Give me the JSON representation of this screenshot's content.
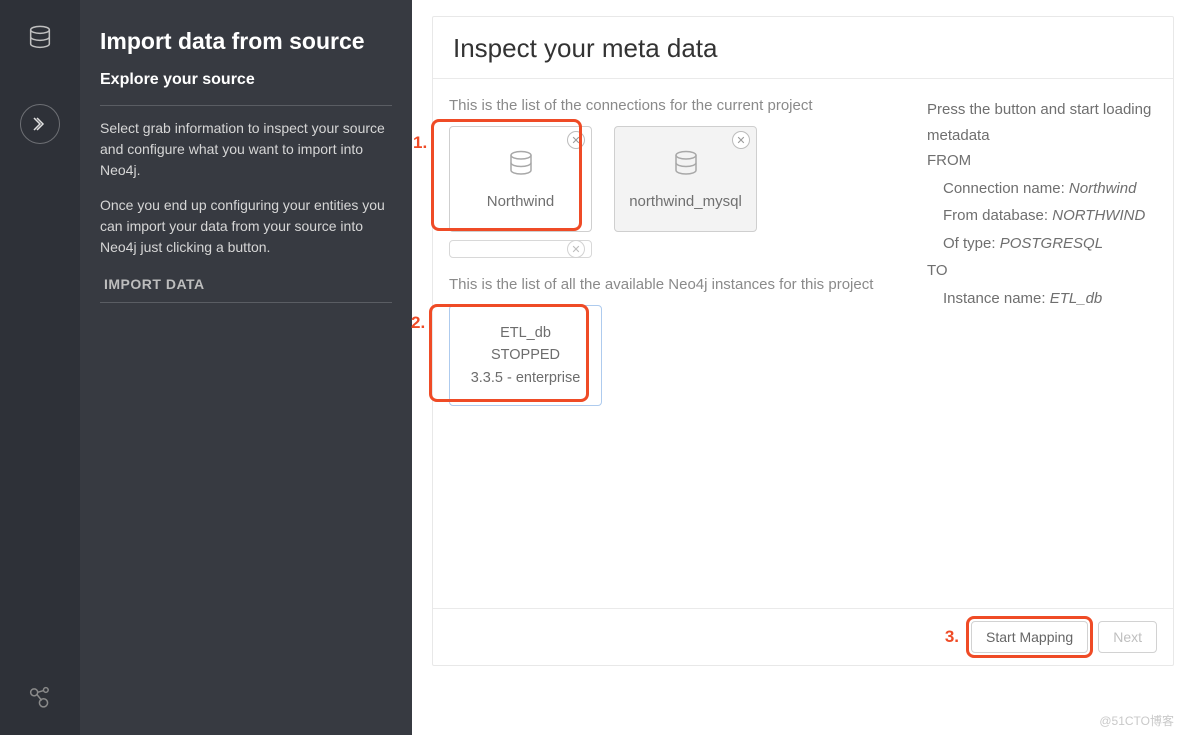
{
  "sidebar": {
    "title": "Import data from source",
    "subtitle": "Explore your source",
    "desc1": "Select grab information to inspect your source and configure what you want to import into Neo4j.",
    "desc2": "Once you end up configuring your entities you can import your data from your source into Neo4j just clicking a button.",
    "action": "IMPORT DATA"
  },
  "main": {
    "title": "Inspect your meta data",
    "connections_label": "This is the list of the connections for the current project",
    "instances_label": "This is the list of all the available Neo4j instances for this project",
    "connections": [
      {
        "name": "Northwind",
        "selected": true
      },
      {
        "name": "northwind_mysql",
        "selected": false
      }
    ],
    "instance": {
      "name": "ETL_db",
      "status": "STOPPED",
      "version": "3.3.5 - enterprise"
    }
  },
  "info": {
    "lead": "Press the button and start loading metadata",
    "from_label": "FROM",
    "conn_label": "Connection name:",
    "conn_value": "Northwind",
    "db_label": "From database:",
    "db_value": "NORTHWIND",
    "type_label": "Of type:",
    "type_value": "POSTGRESQL",
    "to_label": "TO",
    "inst_label": "Instance name:",
    "inst_value": "ETL_db"
  },
  "footer": {
    "start": "Start Mapping",
    "next": "Next"
  },
  "annotations": {
    "a1": "1.",
    "a2": "2.",
    "a3": "3."
  },
  "watermark": "@51CTO博客"
}
